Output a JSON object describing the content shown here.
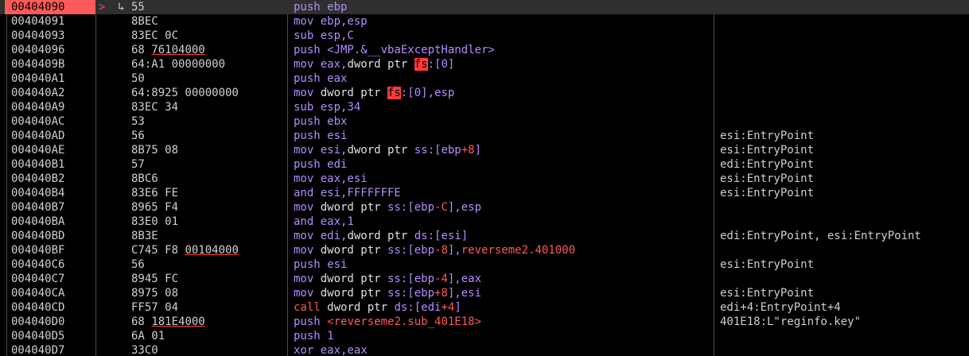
{
  "selected_row": 0,
  "rows": [
    {
      "addr": "00404090",
      "arrow": ">",
      "jmp": "↳",
      "bytes": "55",
      "dis": "push ebp",
      "comment": ""
    },
    {
      "addr": "00404091",
      "bytes": "8BEC",
      "dis": "mov ebp,esp",
      "comment": ""
    },
    {
      "addr": "00404093",
      "bytes": "83EC 0C",
      "dis": "sub esp,C",
      "comment": ""
    },
    {
      "addr": "00404096",
      "bytes": "68 76104000",
      "dis": "push <JMP.&__vbaExceptHandler>",
      "comment": ""
    },
    {
      "addr": "0040409B",
      "bytes": "64:A1 00000000",
      "dis": "mov eax,dword ptr fs:[0]",
      "comment": ""
    },
    {
      "addr": "004040A1",
      "bytes": "50",
      "dis": "push eax",
      "comment": ""
    },
    {
      "addr": "004040A2",
      "bytes": "64:8925 00000000",
      "dis": "mov dword ptr fs:[0],esp",
      "comment": ""
    },
    {
      "addr": "004040A9",
      "bytes": "83EC 34",
      "dis": "sub esp,34",
      "comment": ""
    },
    {
      "addr": "004040AC",
      "bytes": "53",
      "dis": "push ebx",
      "comment": ""
    },
    {
      "addr": "004040AD",
      "bytes": "56",
      "dis": "push esi",
      "comment": "esi:EntryPoint"
    },
    {
      "addr": "004040AE",
      "bytes": "8B75 08",
      "dis": "mov esi,dword ptr ss:[ebp+8]",
      "comment": "esi:EntryPoint"
    },
    {
      "addr": "004040B1",
      "bytes": "57",
      "dis": "push edi",
      "comment": "edi:EntryPoint"
    },
    {
      "addr": "004040B2",
      "bytes": "8BC6",
      "dis": "mov eax,esi",
      "comment": "esi:EntryPoint"
    },
    {
      "addr": "004040B4",
      "bytes": "83E6 FE",
      "dis": "and esi,FFFFFFFE",
      "comment": "esi:EntryPoint"
    },
    {
      "addr": "004040B7",
      "bytes": "8965 F4",
      "dis": "mov dword ptr ss:[ebp-C],esp",
      "comment": ""
    },
    {
      "addr": "004040BA",
      "bytes": "83E0 01",
      "dis": "and eax,1",
      "comment": ""
    },
    {
      "addr": "004040BD",
      "bytes": "8B3E",
      "dis": "mov edi,dword ptr ds:[esi]",
      "comment": "edi:EntryPoint, esi:EntryPoint"
    },
    {
      "addr": "004040BF",
      "bytes": "C745 F8 00104000",
      "dis": "mov dword ptr ss:[ebp-8],reverseme2.401000",
      "comment": ""
    },
    {
      "addr": "004040C6",
      "bytes": "56",
      "dis": "push esi",
      "comment": "esi:EntryPoint"
    },
    {
      "addr": "004040C7",
      "bytes": "8945 FC",
      "dis": "mov dword ptr ss:[ebp-4],eax",
      "comment": ""
    },
    {
      "addr": "004040CA",
      "bytes": "8975 08",
      "dis": "mov dword ptr ss:[ebp+8],esi",
      "comment": "esi:EntryPoint"
    },
    {
      "addr": "004040CD",
      "bytes": "FF57 04",
      "dis": "call dword ptr ds:[edi+4]",
      "comment": "edi+4:EntryPoint+4"
    },
    {
      "addr": "004040D0",
      "bytes": "68 181E4000",
      "dis": "push <reverseme2.sub_401E18>",
      "comment": "401E18:L\"reginfo.key\""
    },
    {
      "addr": "004040D5",
      "bytes": "6A 01",
      "dis": "push 1",
      "comment": ""
    },
    {
      "addr": "004040D7",
      "bytes": "33C0",
      "dis": "xor eax,eax",
      "comment": ""
    }
  ],
  "colors": {
    "background": "#000000",
    "selection": "#ff5a5a",
    "mnemonic": "#b48cff",
    "address_operand": "#ff5a5a",
    "text": "#cfcfcf"
  }
}
